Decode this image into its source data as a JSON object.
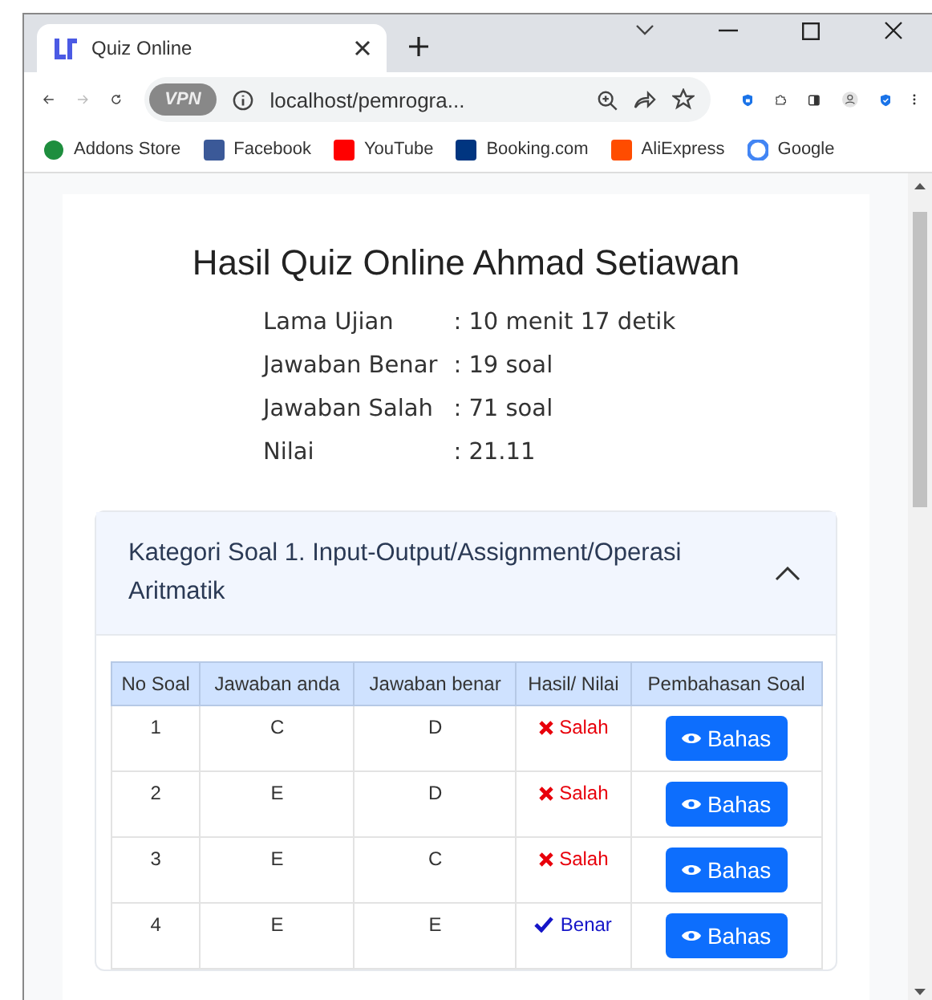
{
  "browser": {
    "tab": {
      "title": "Quiz Online",
      "selected": true
    },
    "address": {
      "badge": "VPN",
      "url": "localhost/pemrogra..."
    },
    "bookmarks": [
      {
        "label": "Addons Store",
        "kind": "addons"
      },
      {
        "label": "Facebook",
        "kind": "facebook"
      },
      {
        "label": "YouTube",
        "kind": "youtube"
      },
      {
        "label": "Booking.com",
        "kind": "booking"
      },
      {
        "label": "AliExpress",
        "kind": "aliexpress"
      },
      {
        "label": "Google",
        "kind": "google"
      }
    ]
  },
  "page": {
    "title": "Hasil Quiz Online Ahmad Setiawan",
    "summary": [
      {
        "label": "Lama Ujian",
        "value": ": 10 menit 17 detik"
      },
      {
        "label": "Jawaban Benar",
        "value": ": 19 soal"
      },
      {
        "label": "Jawaban Salah",
        "value": ": 71 soal"
      },
      {
        "label": "Nilai",
        "value": ": 21.11"
      }
    ],
    "category": {
      "title": "Kategori Soal 1. Input-Output/Assignment/Operasi Aritmatik",
      "expanded": true,
      "table": {
        "columns": [
          "No Soal",
          "Jawaban anda",
          "Jawaban benar",
          "Hasil/ Nilai",
          "Pembahasan Soal"
        ],
        "rows": [
          {
            "no": "1",
            "answer": "C",
            "key": "D",
            "result": "Salah",
            "kind": "wrong",
            "button": "Bahas"
          },
          {
            "no": "2",
            "answer": "E",
            "key": "D",
            "result": "Salah",
            "kind": "wrong",
            "button": "Bahas"
          },
          {
            "no": "3",
            "answer": "E",
            "key": "C",
            "result": "Salah",
            "kind": "wrong",
            "button": "Bahas"
          },
          {
            "no": "4",
            "answer": "E",
            "key": "E",
            "result": "Benar",
            "kind": "right",
            "button": "Bahas"
          }
        ]
      }
    }
  }
}
